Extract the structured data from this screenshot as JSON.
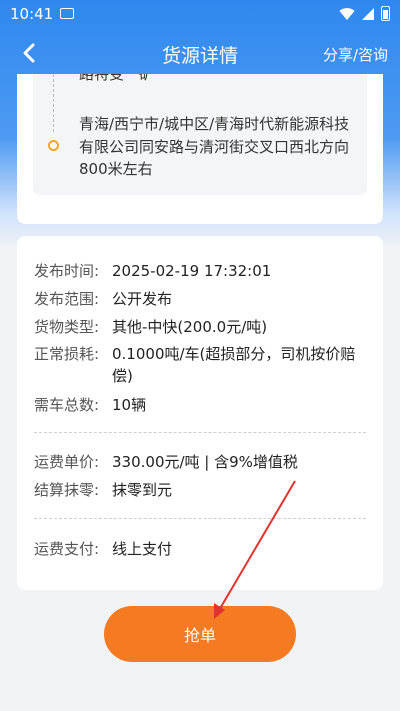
{
  "status": {
    "time": "10:41"
  },
  "nav": {
    "title": "货源详情",
    "share": "分享/咨询"
  },
  "address": {
    "top_fragment": "路特变一矿",
    "detail": "青海/西宁市/城中区/青海时代新能源科技有限公司同安路与清河街交叉口西北方向800米左右"
  },
  "info": {
    "publish_time_label": "发布时间:",
    "publish_time": "2025-02-19 17:32:01",
    "publish_scope_label": "发布范围:",
    "publish_scope": "公开发布",
    "goods_type_label": "货物类型:",
    "goods_type": "其他-中快(200.0元/吨)",
    "loss_label": "正常损耗:",
    "loss": "0.1000吨/车(超损部分，司机按价赔偿)",
    "vehicles_label": "需车总数:",
    "vehicles": "10辆",
    "unit_price_label": "运费单价:",
    "unit_price": "330.00元/吨 | 含9%增值税",
    "rounding_label": "结算抹零:",
    "rounding": "抹零到元",
    "payment_label": "运费支付:",
    "payment": "线上支付"
  },
  "action": {
    "grab_label": "抢单"
  },
  "colors": {
    "primary": "#2f88ee",
    "accent": "#f57a22",
    "arrow": "#e0332f"
  }
}
